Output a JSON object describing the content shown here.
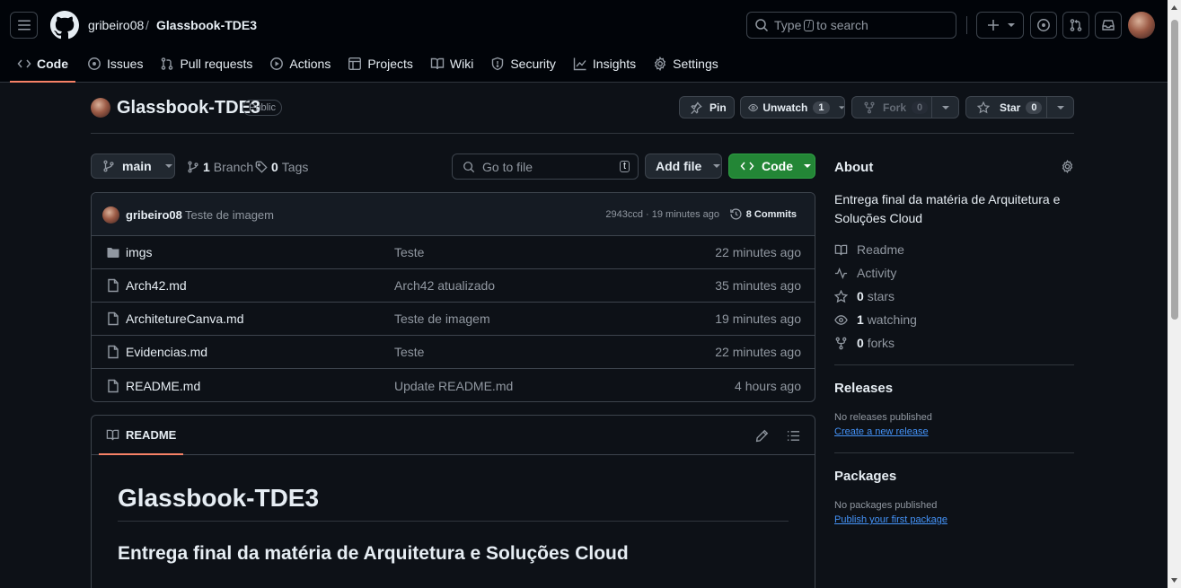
{
  "header": {
    "owner": "gribeiro08",
    "separator": "/",
    "repo": "Glassbook-TDE3",
    "search_prefix": "Type",
    "search_key": "/",
    "search_suffix": "to search"
  },
  "tabs": [
    {
      "label": "Code",
      "icon": "code-icon"
    },
    {
      "label": "Issues",
      "icon": "issue-icon"
    },
    {
      "label": "Pull requests",
      "icon": "pull-request-icon"
    },
    {
      "label": "Actions",
      "icon": "play-icon"
    },
    {
      "label": "Projects",
      "icon": "table-icon"
    },
    {
      "label": "Wiki",
      "icon": "book-icon"
    },
    {
      "label": "Security",
      "icon": "shield-icon"
    },
    {
      "label": "Insights",
      "icon": "graph-icon"
    },
    {
      "label": "Settings",
      "icon": "gear-icon"
    }
  ],
  "repo": {
    "name": "Glassbook-TDE3",
    "visibility": "Public",
    "pin_label": "Pin",
    "unwatch_label": "Unwatch",
    "watch_count": "1",
    "fork_label": "Fork",
    "fork_count": "0",
    "star_label": "Star",
    "star_count": "0"
  },
  "toolbar": {
    "branch": "main",
    "branch_count": "1",
    "branch_label": "Branch",
    "tag_count": "0",
    "tag_label": "Tags",
    "goto_placeholder": "Go to file",
    "goto_key": "t",
    "add_file": "Add file",
    "code": "Code"
  },
  "commit": {
    "author": "gribeiro08",
    "message": "Teste de imagem",
    "hash_time": "2943ccd · 19 minutes ago",
    "commits": "8 Commits"
  },
  "files": [
    {
      "name": "imgs",
      "type": "folder",
      "message": "Teste",
      "time": "22 minutes ago"
    },
    {
      "name": "Arch42.md",
      "type": "file",
      "message": "Arch42 atualizado",
      "time": "35 minutes ago"
    },
    {
      "name": "ArchitetureCanva.md",
      "type": "file",
      "message": "Teste de imagem",
      "time": "19 minutes ago"
    },
    {
      "name": "Evidencias.md",
      "type": "file",
      "message": "Teste",
      "time": "22 minutes ago"
    },
    {
      "name": "README.md",
      "type": "file",
      "message": "Update README.md",
      "time": "4 hours ago"
    }
  ],
  "readme": {
    "tab": "README",
    "h1": "Glassbook-TDE3",
    "h2": "Entrega final da matéria de Arquitetura e Soluções Cloud"
  },
  "about": {
    "title": "About",
    "description": "Entrega final da matéria de Arquitetura e Soluções Cloud",
    "readme": "Readme",
    "activity": "Activity",
    "stars_count": "0",
    "stars_label": "stars",
    "watching_count": "1",
    "watching_label": "watching",
    "forks_count": "0",
    "forks_label": "forks"
  },
  "releases": {
    "title": "Releases",
    "empty": "No releases published",
    "link": "Create a new release"
  },
  "packages": {
    "title": "Packages",
    "empty": "No packages published",
    "link": "Publish your first package"
  },
  "colors": {
    "accent_tab": "#f78166",
    "code_button": "#238636",
    "link": "#4493f8"
  }
}
